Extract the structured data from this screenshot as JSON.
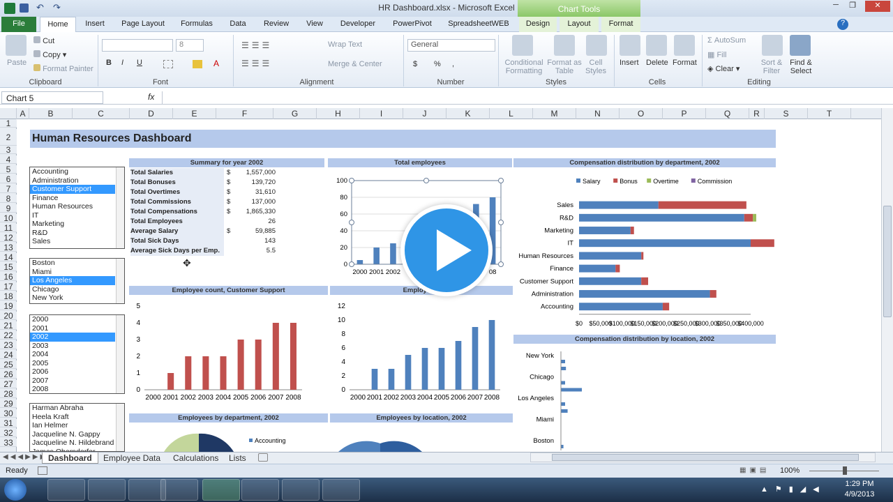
{
  "window": {
    "title": "HR Dashboard.xlsx - Microsoft Excel",
    "chart_tools": "Chart Tools"
  },
  "menu": {
    "tabs": [
      "File",
      "Home",
      "Insert",
      "Page Layout",
      "Formulas",
      "Data",
      "Review",
      "View",
      "Developer",
      "PowerPivot",
      "SpreadsheetWEB",
      "Design",
      "Layout",
      "Format"
    ]
  },
  "ribbon": {
    "clipboard": {
      "paste": "Paste",
      "cut": "Cut",
      "copy": "Copy",
      "format_painter": "Format Painter",
      "label": "Clipboard"
    },
    "font": {
      "size": "8",
      "bold": "B",
      "italic": "I",
      "underline": "U",
      "label": "Font"
    },
    "alignment": {
      "wrap": "Wrap Text",
      "merge": "Merge & Center",
      "label": "Alignment"
    },
    "number": {
      "format": "General",
      "dollar": "$",
      "percent": "%",
      "comma": ",",
      "label": "Number"
    },
    "styles": {
      "conditional": "Conditional Formatting",
      "format_table": "Format as Table",
      "cell_styles": "Cell Styles",
      "label": "Styles"
    },
    "cells": {
      "insert": "Insert",
      "delete": "Delete",
      "format": "Format",
      "label": "Cells"
    },
    "editing": {
      "autosum": "AutoSum",
      "fill": "Fill",
      "clear": "Clear",
      "sort": "Sort & Filter",
      "find": "Find & Select",
      "label": "Editing"
    }
  },
  "formula_bar": {
    "name_box": "Chart 5",
    "fx": "fx"
  },
  "columns": [
    "A",
    "B",
    "C",
    "D",
    "E",
    "F",
    "G",
    "H",
    "I",
    "J",
    "K",
    "L",
    "M",
    "N",
    "O",
    "P",
    "Q",
    "R",
    "S",
    "T"
  ],
  "rows": [
    "1",
    "2",
    "3",
    "4",
    "5",
    "6",
    "7",
    "8",
    "9",
    "10",
    "11",
    "12",
    "13",
    "14",
    "15",
    "16",
    "17",
    "18",
    "19",
    "20",
    "21",
    "22",
    "23",
    "24",
    "25",
    "26",
    "27",
    "28",
    "29",
    "30",
    "31",
    "32",
    "33"
  ],
  "dashboard": {
    "title": "Human Resources Dashboard"
  },
  "listboxes": {
    "departments": [
      "Accounting",
      "Administration",
      "Customer Support",
      "Finance",
      "Human Resources",
      "IT",
      "Marketing",
      "R&D",
      "Sales"
    ],
    "departments_selected": "Customer Support",
    "cities": [
      "Boston",
      "Miami",
      "Los Angeles",
      "Chicago",
      "New York"
    ],
    "cities_selected": "Los Angeles",
    "years": [
      "2000",
      "2001",
      "2002",
      "2003",
      "2004",
      "2005",
      "2006",
      "2007",
      "2008"
    ],
    "years_selected": "2002",
    "employees": [
      "Harman Abraha",
      "Heela Kraft",
      "Ian Helmer",
      "Jacqueline N. Gappy",
      "Jacqueline N. Hildebrand",
      "James Oberndorfer"
    ]
  },
  "summary": {
    "title": "Summary for year 2002",
    "rows": [
      {
        "label": "Total Salaries",
        "cur": "$",
        "value": "1,557,000"
      },
      {
        "label": "Total Bonuses",
        "cur": "$",
        "value": "139,720"
      },
      {
        "label": "Total Overtimes",
        "cur": "$",
        "value": "31,610"
      },
      {
        "label": "Total Commissions",
        "cur": "$",
        "value": "137,000"
      },
      {
        "label": "Total Compensations",
        "cur": "$",
        "value": "1,865,330"
      },
      {
        "label": "Total Employees",
        "cur": "",
        "value": "26"
      },
      {
        "label": "Average Salary",
        "cur": "$",
        "value": "59,885"
      },
      {
        "label": "Total Sick Days",
        "cur": "",
        "value": "143"
      },
      {
        "label": "Average Sick Days per Emp.",
        "cur": "",
        "value": "5.5"
      }
    ]
  },
  "section_titles": {
    "total_employees": "Total employees",
    "comp_dept": "Compensation distribution by department, 2002",
    "emp_count": "Employee count, Customer Support",
    "emp_count2": "Employee c",
    "comp_loc": "Compensation distribution by location, 2002",
    "emp_dept": "Employees by department, 2002",
    "emp_loc": "Employees by location, 2002"
  },
  "chart_data": [
    {
      "type": "bar",
      "name": "Total employees",
      "categories": [
        "2000",
        "2001",
        "2002",
        "2003",
        "2004",
        "2005",
        "2006",
        "2007",
        "2008"
      ],
      "values": [
        5,
        20,
        25,
        30,
        35,
        45,
        55,
        72,
        80
      ],
      "ylim": [
        0,
        100
      ],
      "yticks": [
        0,
        20,
        40,
        60,
        80,
        100
      ],
      "x_tick_labels": [
        "2000",
        "2001",
        "2002",
        "08"
      ]
    },
    {
      "type": "bar",
      "name": "Employee count, Customer Support",
      "categories": [
        "2000",
        "2001",
        "2002",
        "2003",
        "2004",
        "2005",
        "2006",
        "2007",
        "2008"
      ],
      "values": [
        0,
        1,
        2,
        2,
        2,
        3,
        3,
        4,
        4
      ],
      "ylim": [
        0,
        5
      ],
      "yticks": [
        0,
        1,
        2,
        3,
        4,
        5
      ],
      "color": "#c0504d"
    },
    {
      "type": "bar",
      "name": "Employee count",
      "categories": [
        "2000",
        "2001",
        "2002",
        "2003",
        "2004",
        "2005",
        "2006",
        "2007",
        "2008"
      ],
      "values": [
        0,
        3,
        3,
        5,
        6,
        6,
        7,
        9,
        10
      ],
      "ylim": [
        0,
        12
      ],
      "yticks": [
        0,
        2,
        4,
        6,
        8,
        10,
        12
      ],
      "color": "#4f81bd"
    },
    {
      "type": "bar",
      "orientation": "horizontal",
      "stacked": true,
      "name": "Compensation distribution by department, 2002",
      "categories": [
        "Sales",
        "R&D",
        "Marketing",
        "IT",
        "Human Resources",
        "Finance",
        "Customer Support",
        "Administration",
        "Accounting"
      ],
      "series": [
        {
          "name": "Salary",
          "color": "#4f81bd",
          "values": [
            185000,
            385000,
            120000,
            400000,
            145000,
            85000,
            145000,
            305000,
            195000
          ]
        },
        {
          "name": "Bonus",
          "color": "#c0504d",
          "values": [
            205000,
            20000,
            8000,
            55000,
            5000,
            10000,
            16000,
            15000,
            15000
          ]
        },
        {
          "name": "Overtime",
          "color": "#9bbb59",
          "values": [
            0,
            8000,
            0,
            0,
            0,
            0,
            0,
            0,
            0
          ]
        },
        {
          "name": "Commission",
          "color": "#8064a2",
          "values": [
            0,
            0,
            0,
            0,
            0,
            0,
            0,
            0,
            0
          ]
        }
      ],
      "xticks": [
        "$0",
        "$50,000",
        "$100,000",
        "$150,000",
        "$200,000",
        "$250,000",
        "$300,000",
        "$350,000",
        "$400,000"
      ],
      "xlim": [
        0,
        400000
      ]
    },
    {
      "type": "bar",
      "orientation": "horizontal",
      "name": "Compensation distribution by location, 2002",
      "categories": [
        "New York",
        "Chicago",
        "Los Angeles",
        "Miami",
        "Boston"
      ],
      "visible_labels": [
        "New York",
        "Chicago",
        "Los Angeles",
        "Miami",
        "Boston"
      ]
    },
    {
      "type": "pie",
      "name": "Employees by department, 2002",
      "legend_visible": [
        "Accounting"
      ]
    }
  ],
  "sheet_tabs": [
    "Dashboard",
    "Employee Data",
    "Calculations",
    "Lists"
  ],
  "status": {
    "ready": "Ready",
    "zoom": "100%"
  },
  "clock": {
    "time": "1:29 PM",
    "date": "4/9/2013"
  }
}
